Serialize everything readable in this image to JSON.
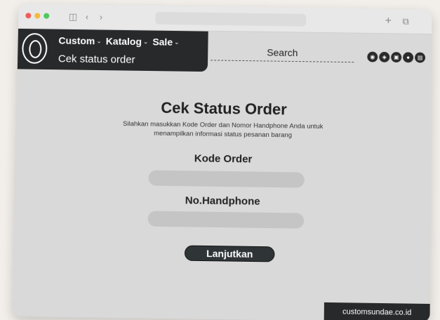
{
  "colors": {
    "dot_red": "#f25c56",
    "dot_yellow": "#f6b93b",
    "dot_green": "#4cc95a",
    "nav_bg": "#27292b",
    "button_bg": "#2f3437"
  },
  "nav": {
    "menu": [
      {
        "label": "Custom"
      },
      {
        "label": "Katalog"
      },
      {
        "label": "Sale"
      }
    ],
    "subtitle": "Cek status order"
  },
  "search": {
    "label": "Search"
  },
  "icons": [
    "sticker-icon",
    "gift-icon",
    "clipboard-icon",
    "user-icon",
    "cart-icon"
  ],
  "main": {
    "title": "Cek Status Order",
    "description": "Silahkan masukkan Kode Order dan Nomor Handphone Anda untuk menampilkan informasi status pesanan barang",
    "order_code_label": "Kode Order",
    "order_code_value": "",
    "phone_label": "No.Handphone",
    "phone_value": "",
    "submit_label": "Lanjutkan"
  },
  "footer": {
    "domain": "customsundae.co.id"
  }
}
